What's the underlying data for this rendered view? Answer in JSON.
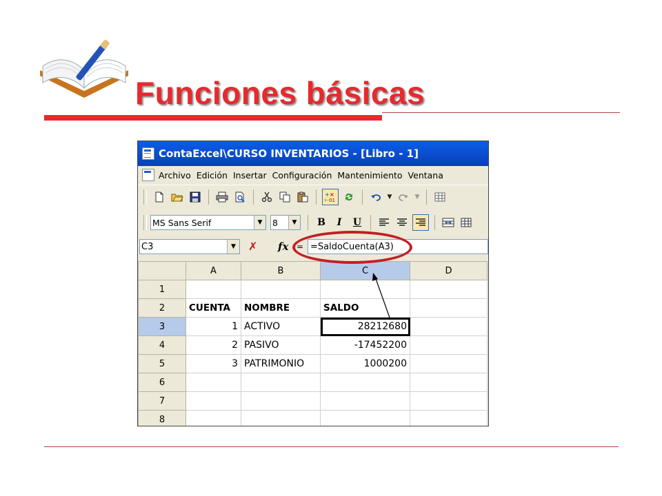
{
  "slide": {
    "title": "Funciones básicas"
  },
  "window": {
    "title": "ContaExcel\\CURSO INVENTARIOS - [Libro - 1]"
  },
  "menu": [
    "Archivo",
    "Edición",
    "Insertar",
    "Configuración",
    "Mantenimiento",
    "Ventana"
  ],
  "toolbar": {
    "icons": [
      "new-document-icon",
      "open-folder-icon",
      "save-icon",
      "print-icon",
      "print-preview-icon",
      "cut-icon",
      "copy-icon",
      "paste-icon",
      "insert-function-icon",
      "refresh-icon",
      "undo-icon",
      "redo-icon"
    ]
  },
  "format_toolbar": {
    "font_name": "MS Sans Serif",
    "font_size": "8",
    "bold": "B",
    "italic": "I",
    "underline": "U"
  },
  "formula_bar": {
    "name_box": "C3",
    "cancel": "✗",
    "fx": "fx",
    "equals": "=",
    "formula": "=SaldoCuenta(A3)"
  },
  "sheet": {
    "columns": [
      "A",
      "B",
      "C",
      "D"
    ],
    "rows": [
      "1",
      "2",
      "3",
      "4",
      "5",
      "6",
      "7",
      "8"
    ],
    "cells": [
      [
        "",
        "",
        "",
        ""
      ],
      [
        "CUENTA",
        "NOMBRE",
        "SALDO",
        ""
      ],
      [
        "1",
        "ACTIVO",
        "28212680",
        ""
      ],
      [
        "2",
        "PASIVO",
        "-17452200",
        ""
      ],
      [
        "3",
        "PATRIMONIO",
        "1000200",
        ""
      ],
      [
        "",
        "",
        "",
        ""
      ],
      [
        "",
        "",
        "",
        ""
      ],
      [
        "",
        "",
        "",
        ""
      ]
    ],
    "selected_cell": "C3"
  },
  "colors": {
    "accent": "#e8292d",
    "titlebar": "#0a4fd8",
    "highlight_ring": "#c41e25"
  }
}
